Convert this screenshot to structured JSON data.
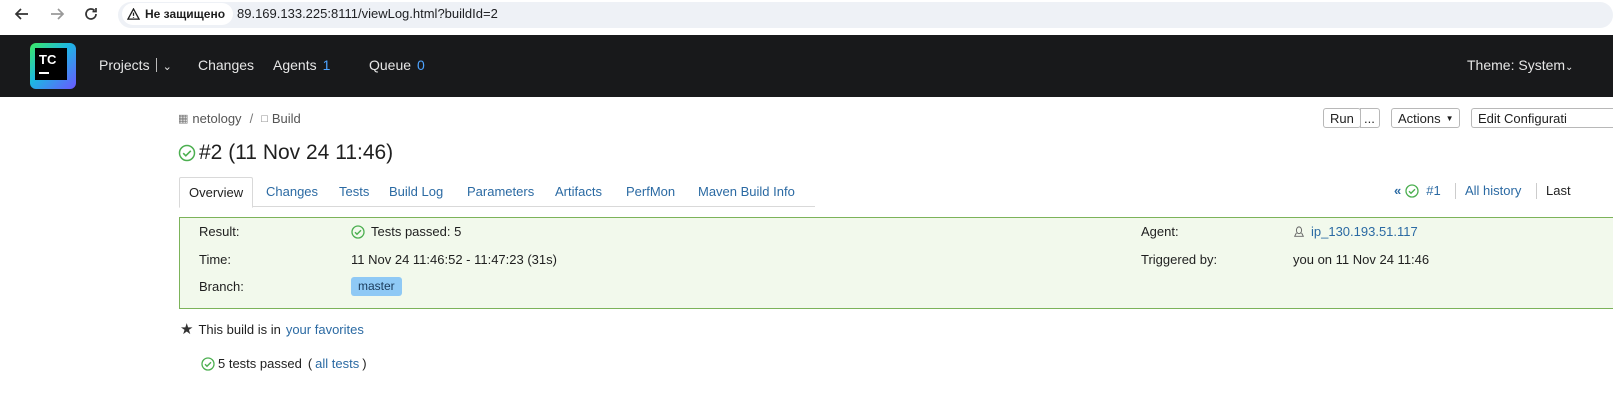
{
  "browser": {
    "security_label": "Не защищено",
    "url": "89.169.133.225:8111/viewLog.html?buildId=2"
  },
  "header": {
    "logo_text": "TC",
    "projects": "Projects",
    "changes": "Changes",
    "agents": "Agents",
    "agents_count": "1",
    "queue": "Queue",
    "queue_count": "0",
    "theme": "Theme: System"
  },
  "breadcrumb": {
    "project": "netology",
    "separator": "/",
    "build_config": "Build"
  },
  "actions": {
    "run": "Run",
    "more": "...",
    "actions": "Actions",
    "edit": "Edit Configurati"
  },
  "title": "#2 (11 Nov 24 11:46)",
  "tabs": [
    {
      "label": "Overview"
    },
    {
      "label": "Changes"
    },
    {
      "label": "Tests"
    },
    {
      "label": "Build Log"
    },
    {
      "label": "Parameters"
    },
    {
      "label": "Artifacts"
    },
    {
      "label": "PerfMon"
    },
    {
      "label": "Maven Build Info"
    }
  ],
  "history": {
    "prev": "#1",
    "all": "All history",
    "last": "Last"
  },
  "summary": {
    "result_label": "Result:",
    "result_value": "Tests passed: 5",
    "time_label": "Time:",
    "time_value": "11 Nov 24 11:46:52 - 11:47:23 (31s)",
    "branch_label": "Branch:",
    "branch_value": "master",
    "agent_label": "Agent:",
    "agent_value": "ip_130.193.51.117",
    "triggered_label": "Triggered by:",
    "triggered_value": "you on 11 Nov 24 11:46"
  },
  "favorites": {
    "text": "This build is in",
    "link": "your favorites"
  },
  "tests": {
    "text": "5 tests passed",
    "open": "(",
    "link": "all tests",
    "close": ")"
  },
  "colors": {
    "header_bg": "#18191b",
    "link": "#2b6aa3",
    "success": "#4caf50",
    "panel_bg": "#f2f9ec",
    "panel_border": "#7cb35a",
    "branch_bg": "#8fc9f5"
  }
}
